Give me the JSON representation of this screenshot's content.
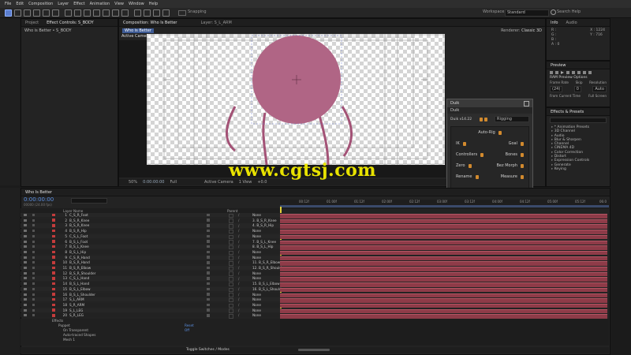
{
  "menu": [
    "File",
    "Edit",
    "Composition",
    "Layer",
    "Effect",
    "Animation",
    "View",
    "Window",
    "Help"
  ],
  "toolbar": {
    "snapping": "Snapping",
    "workspace_label": "Workspace:",
    "workspace_value": "Standard",
    "search_placeholder": "Search Help"
  },
  "project_panel": {
    "tabs": [
      "Project",
      "Effect Controls: S_BODY"
    ],
    "breadcrumb": "Who is Better • S_BODY"
  },
  "comp_panel": {
    "tabs": [
      "Composition: Who Is Better",
      "Layer: S_L_ARM"
    ],
    "subtab": "Who is Better",
    "renderer_label": "Renderer:",
    "renderer_value": "Classic 3D",
    "view_label": "Active Camera",
    "bottom": {
      "zoom": "50%",
      "timecode": "0:00:00:00",
      "resolution": "Full",
      "camera": "Active Camera",
      "views": "1 View",
      "offset": "+0.0"
    }
  },
  "watermark": "www.cgtsj.com",
  "info_panel": {
    "tabs": [
      "Info",
      "Audio"
    ],
    "lines": [
      "R :",
      "G :",
      "B :",
      "A : 0"
    ],
    "coords": [
      "X : 1224",
      "Y : 716"
    ]
  },
  "preview_panel": {
    "title": "Preview",
    "ram_label": "RAM Preview Options",
    "frame_rate_label": "Frame Rate",
    "skip_label": "Skip",
    "resolution_label": "Resolution",
    "frame_rate_value": "(24)",
    "skip_value": "0",
    "resolution_value": "Auto",
    "from_current": "From Current Time",
    "full_screen": "Full Screen"
  },
  "effects_panel": {
    "title": "Effects & Presets",
    "search_placeholder": "",
    "items": [
      "* Animation Presets",
      "3D Channel",
      "Audio",
      "Blur & Sharpen",
      "Channel",
      "CINEMA 4D",
      "Color Correction",
      "Distort",
      "Expression Controls",
      "Generate",
      "Keying"
    ]
  },
  "duik": {
    "title": "Duik",
    "tab": "Duik",
    "version": "Duik v14.22",
    "category": "Rigging",
    "buttons": [
      {
        "left": "Auto-Rig"
      },
      {
        "left": "IK",
        "right": "Goal"
      },
      {
        "left": "Controllers",
        "right": "Bones"
      },
      {
        "left": "Zero",
        "right": "Bez Morph"
      },
      {
        "left": "Rename",
        "right": "Measure"
      }
    ]
  },
  "timeline": {
    "tab": "Who Is Better",
    "timecode": "0:00:00:00",
    "fps": "00000 (24.00 fps)",
    "col_layer_name": "Layer Name",
    "col_parent": "Parent",
    "ruler": [
      "00:12f",
      "01:00f",
      "01:12f",
      "02:00f",
      "02:12f",
      "03:00f",
      "03:12f",
      "04:00f",
      "04:12f",
      "05:00f",
      "05:12f",
      "06:0"
    ],
    "layers": [
      {
        "num": "1",
        "name": "C_S_R_Foot",
        "parent": "None"
      },
      {
        "num": "2",
        "name": "B_S_R_Knee",
        "parent": "3. B_S_R_Knee"
      },
      {
        "num": "3",
        "name": "B_S_R_Knee",
        "parent": "4. B_S_R_Hip"
      },
      {
        "num": "4",
        "name": "B_S_R_Hip",
        "parent": "None"
      },
      {
        "num": "5",
        "name": "C_S_L_Foot",
        "parent": "None"
      },
      {
        "num": "6",
        "name": "B_S_L_Foot",
        "parent": "7. B_S_L_Knee"
      },
      {
        "num": "7",
        "name": "B_S_L_Knee",
        "parent": "8. B_S_L_Hip"
      },
      {
        "num": "8",
        "name": "B_S_L_Hip",
        "parent": "None"
      },
      {
        "num": "9",
        "name": "C_S_R_Hand",
        "parent": "None"
      },
      {
        "num": "10",
        "name": "B_S_R_Hand",
        "parent": "11. B_S_R_Elbow"
      },
      {
        "num": "11",
        "name": "B_S_R_Elbow",
        "parent": "12. B_S_R_Shoulder"
      },
      {
        "num": "12",
        "name": "B_S_R_Shoulder",
        "parent": "None"
      },
      {
        "num": "13",
        "name": "C_S_L_Hand",
        "parent": "None"
      },
      {
        "num": "14",
        "name": "B_S_L_Hand",
        "parent": "15. B_S_L_Elbow"
      },
      {
        "num": "15",
        "name": "B_S_L_Elbow",
        "parent": "16. B_S_L_Shoulder"
      },
      {
        "num": "16",
        "name": "B_S_L_Shoulder",
        "parent": "None"
      },
      {
        "num": "17",
        "name": "S_L_ARM",
        "parent": "None"
      },
      {
        "num": "18",
        "name": "S_R_ARM",
        "parent": "None"
      },
      {
        "num": "19",
        "name": "S_L_LEG",
        "parent": "None"
      },
      {
        "num": "20",
        "name": "S_R_LEG",
        "parent": "None"
      }
    ],
    "effects_tree": [
      "Effects",
      "Puppet",
      "On Transparent",
      "Auto-traced Shapes",
      "Mesh 1"
    ],
    "puppet_reset": "Reset",
    "puppet_value": "Off",
    "toggle_label": "Toggle Switches / Modes"
  },
  "colors": {
    "accent": "#5b7ecf",
    "layer_red": "#c43c3c",
    "bar": "#8e3b48",
    "body": "#b06585",
    "duik_orange": "#d28a2e",
    "watermark": "#e8e200"
  }
}
